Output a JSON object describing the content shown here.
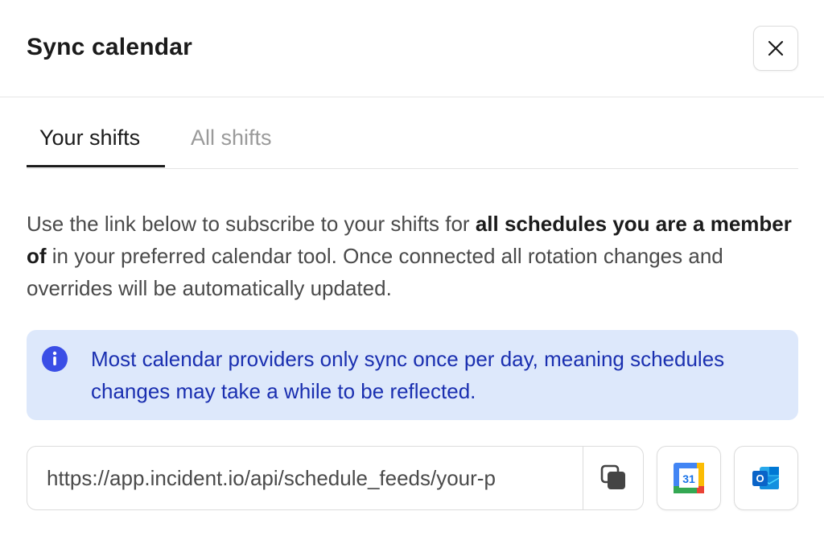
{
  "header": {
    "title": "Sync calendar",
    "close_icon": "close-icon"
  },
  "tabs": [
    {
      "label": "Your shifts",
      "active": true
    },
    {
      "label": "All shifts",
      "active": false
    }
  ],
  "description": {
    "part1": "Use the link below to subscribe to your shifts for ",
    "bold": "all schedules you are a member of",
    "part2": " in your preferred calendar tool. Once connected all rotation changes and overrides will be automatically updated."
  },
  "callout": {
    "icon": "info-icon",
    "text": "Most calendar providers only sync once per day, meaning schedules changes may take a while to be reflected."
  },
  "feed": {
    "url": "https://app.incident.io/api/schedule_feeds/your-p",
    "copy_icon": "copy-icon"
  },
  "integrations": {
    "google_calendar_icon": "google-calendar-icon",
    "google_calendar_day": "31",
    "outlook_icon": "outlook-icon",
    "outlook_letter": "O"
  },
  "colors": {
    "callout_bg": "#dde8fb",
    "callout_text": "#1a2fb0",
    "info_icon": "#3a4ee6"
  }
}
